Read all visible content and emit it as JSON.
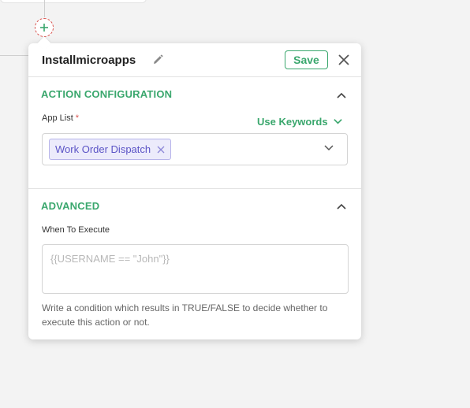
{
  "panel": {
    "title": "Installmicroapps",
    "save_label": "Save"
  },
  "action_configuration": {
    "title": "ACTION CONFIGURATION",
    "app_list_label": "App List",
    "required_mark": "*",
    "use_keywords_label": "Use Keywords",
    "selected_apps": [
      "Work Order Dispatch"
    ]
  },
  "advanced": {
    "title": "ADVANCED",
    "when_label": "When To Execute",
    "condition_placeholder": "{{USERNAME == \"John\"}}",
    "condition_value": "",
    "help_text": "Write a condition which results in TRUE/FALSE to decide whether to execute this action or not."
  },
  "colors": {
    "accent": "#3aa76d",
    "required": "#d9534f",
    "chip_text": "#5b54c6",
    "chip_bg": "#ecebfb"
  },
  "icons": {
    "add_node": "plus-icon",
    "edit": "pencil-icon",
    "close": "close-icon",
    "collapse": "chevron-up-icon",
    "dropdown": "chevron-down-icon",
    "chip_remove": "close-icon"
  }
}
